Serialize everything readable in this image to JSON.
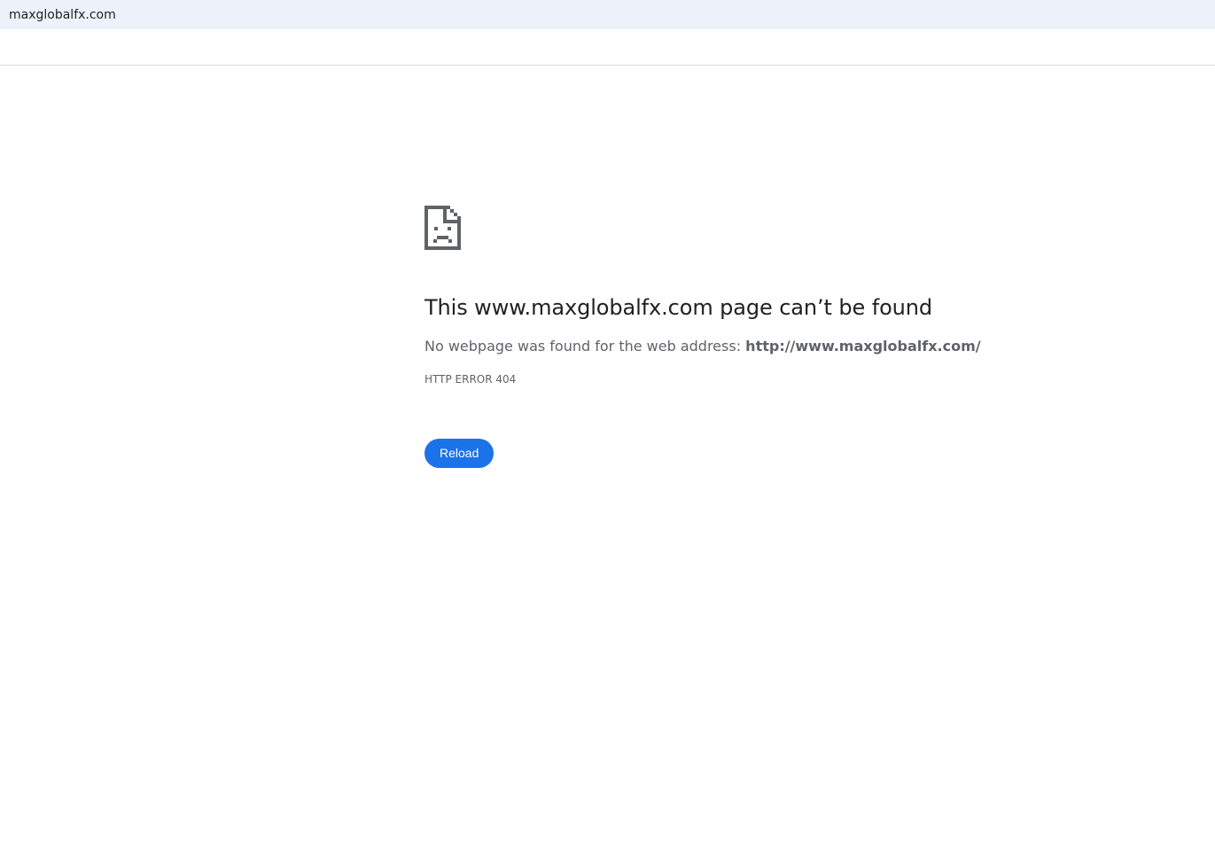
{
  "browser": {
    "address_text": "maxglobalfx.com"
  },
  "error_page": {
    "icon": "sad-page-icon",
    "heading": "This www.maxglobalfx.com page can’t be found",
    "message_prefix": "No webpage was found for the web address: ",
    "message_url": "http://www.maxglobalfx.com/",
    "error_code": "HTTP ERROR 404",
    "reload_label": "Reload"
  },
  "colors": {
    "address_bar_bg": "#edf2fa",
    "heading": "#202124",
    "body_text": "#5f6368",
    "button_bg": "#1a73e8",
    "icon": "#5f6368"
  }
}
